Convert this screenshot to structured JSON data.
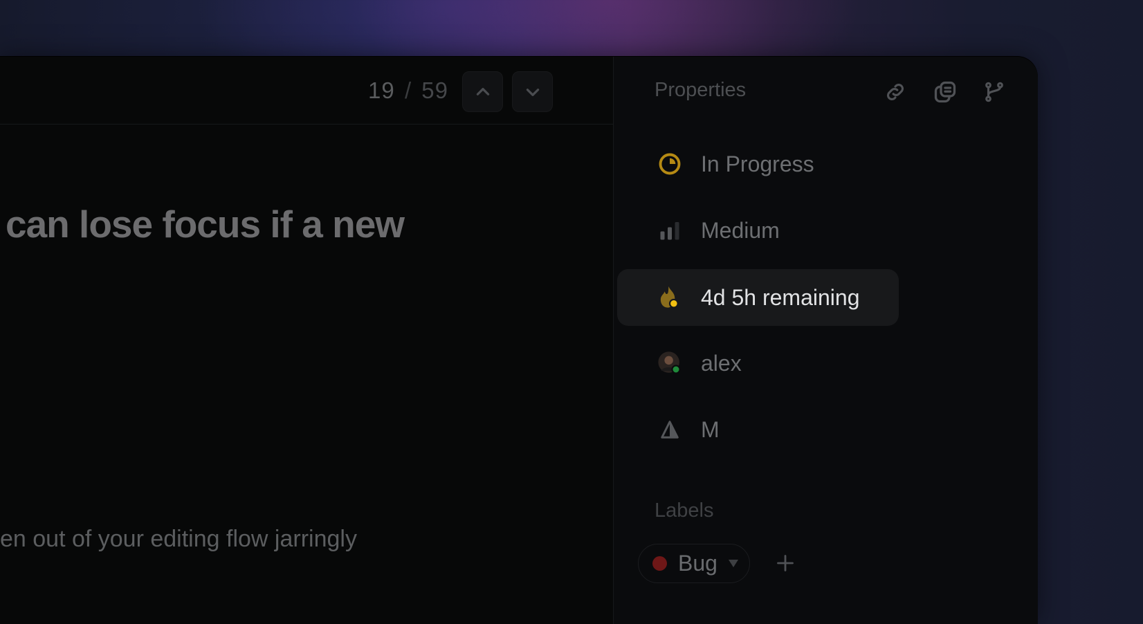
{
  "navigation": {
    "current": "19",
    "separator": "/",
    "total": "59",
    "prev_icon": "chevron-up-icon",
    "next_icon": "chevron-down-icon"
  },
  "issue": {
    "title": "can lose focus if a new",
    "description": "en out of your editing flow jarringly"
  },
  "properties": {
    "title": "Properties",
    "header_icons": [
      "link-icon",
      "copy-icon",
      "branch-icon"
    ],
    "items": [
      {
        "label": "In Progress",
        "icon": "in-progress-status-icon",
        "color": "#b58a14"
      },
      {
        "label": "Medium",
        "icon": "priority-medium-icon",
        "color": "#55575a"
      },
      {
        "label": "4d 5h remaining",
        "icon": "flame-deadline-icon",
        "color": "#a07e1c",
        "badge_color": "#f2c012",
        "active": true
      },
      {
        "label": "alex",
        "icon": "avatar",
        "status_color": "#1f8a3a"
      },
      {
        "label": "M",
        "icon": "estimate-icon",
        "color": "#55575a"
      }
    ]
  },
  "labels": {
    "title": "Labels",
    "items": [
      {
        "label": "Bug",
        "color": "#6e1717"
      }
    ],
    "add_icon": "plus-icon"
  }
}
